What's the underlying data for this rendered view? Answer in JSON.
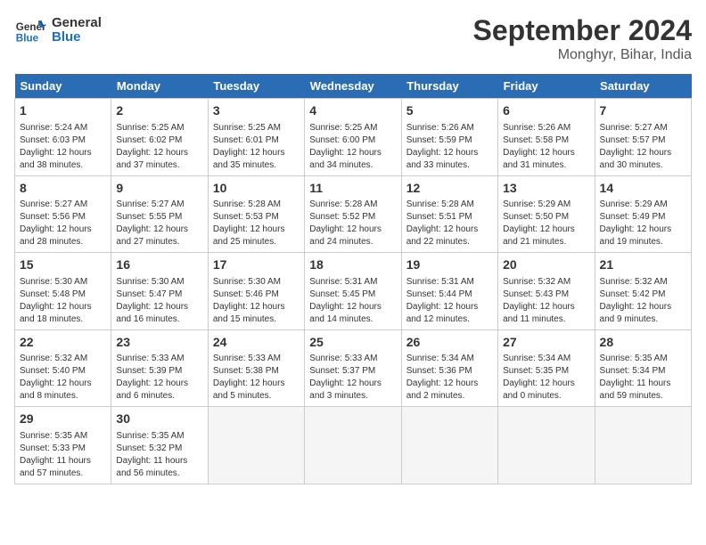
{
  "logo": {
    "line1": "General",
    "line2": "Blue"
  },
  "title": "September 2024",
  "location": "Monghyr, Bihar, India",
  "days_of_week": [
    "Sunday",
    "Monday",
    "Tuesday",
    "Wednesday",
    "Thursday",
    "Friday",
    "Saturday"
  ],
  "weeks": [
    [
      {
        "day": 1,
        "info": "Sunrise: 5:24 AM\nSunset: 6:03 PM\nDaylight: 12 hours\nand 38 minutes."
      },
      {
        "day": 2,
        "info": "Sunrise: 5:25 AM\nSunset: 6:02 PM\nDaylight: 12 hours\nand 37 minutes."
      },
      {
        "day": 3,
        "info": "Sunrise: 5:25 AM\nSunset: 6:01 PM\nDaylight: 12 hours\nand 35 minutes."
      },
      {
        "day": 4,
        "info": "Sunrise: 5:25 AM\nSunset: 6:00 PM\nDaylight: 12 hours\nand 34 minutes."
      },
      {
        "day": 5,
        "info": "Sunrise: 5:26 AM\nSunset: 5:59 PM\nDaylight: 12 hours\nand 33 minutes."
      },
      {
        "day": 6,
        "info": "Sunrise: 5:26 AM\nSunset: 5:58 PM\nDaylight: 12 hours\nand 31 minutes."
      },
      {
        "day": 7,
        "info": "Sunrise: 5:27 AM\nSunset: 5:57 PM\nDaylight: 12 hours\nand 30 minutes."
      }
    ],
    [
      {
        "day": 8,
        "info": "Sunrise: 5:27 AM\nSunset: 5:56 PM\nDaylight: 12 hours\nand 28 minutes."
      },
      {
        "day": 9,
        "info": "Sunrise: 5:27 AM\nSunset: 5:55 PM\nDaylight: 12 hours\nand 27 minutes."
      },
      {
        "day": 10,
        "info": "Sunrise: 5:28 AM\nSunset: 5:53 PM\nDaylight: 12 hours\nand 25 minutes."
      },
      {
        "day": 11,
        "info": "Sunrise: 5:28 AM\nSunset: 5:52 PM\nDaylight: 12 hours\nand 24 minutes."
      },
      {
        "day": 12,
        "info": "Sunrise: 5:28 AM\nSunset: 5:51 PM\nDaylight: 12 hours\nand 22 minutes."
      },
      {
        "day": 13,
        "info": "Sunrise: 5:29 AM\nSunset: 5:50 PM\nDaylight: 12 hours\nand 21 minutes."
      },
      {
        "day": 14,
        "info": "Sunrise: 5:29 AM\nSunset: 5:49 PM\nDaylight: 12 hours\nand 19 minutes."
      }
    ],
    [
      {
        "day": 15,
        "info": "Sunrise: 5:30 AM\nSunset: 5:48 PM\nDaylight: 12 hours\nand 18 minutes."
      },
      {
        "day": 16,
        "info": "Sunrise: 5:30 AM\nSunset: 5:47 PM\nDaylight: 12 hours\nand 16 minutes."
      },
      {
        "day": 17,
        "info": "Sunrise: 5:30 AM\nSunset: 5:46 PM\nDaylight: 12 hours\nand 15 minutes."
      },
      {
        "day": 18,
        "info": "Sunrise: 5:31 AM\nSunset: 5:45 PM\nDaylight: 12 hours\nand 14 minutes."
      },
      {
        "day": 19,
        "info": "Sunrise: 5:31 AM\nSunset: 5:44 PM\nDaylight: 12 hours\nand 12 minutes."
      },
      {
        "day": 20,
        "info": "Sunrise: 5:32 AM\nSunset: 5:43 PM\nDaylight: 12 hours\nand 11 minutes."
      },
      {
        "day": 21,
        "info": "Sunrise: 5:32 AM\nSunset: 5:42 PM\nDaylight: 12 hours\nand 9 minutes."
      }
    ],
    [
      {
        "day": 22,
        "info": "Sunrise: 5:32 AM\nSunset: 5:40 PM\nDaylight: 12 hours\nand 8 minutes."
      },
      {
        "day": 23,
        "info": "Sunrise: 5:33 AM\nSunset: 5:39 PM\nDaylight: 12 hours\nand 6 minutes."
      },
      {
        "day": 24,
        "info": "Sunrise: 5:33 AM\nSunset: 5:38 PM\nDaylight: 12 hours\nand 5 minutes."
      },
      {
        "day": 25,
        "info": "Sunrise: 5:33 AM\nSunset: 5:37 PM\nDaylight: 12 hours\nand 3 minutes."
      },
      {
        "day": 26,
        "info": "Sunrise: 5:34 AM\nSunset: 5:36 PM\nDaylight: 12 hours\nand 2 minutes."
      },
      {
        "day": 27,
        "info": "Sunrise: 5:34 AM\nSunset: 5:35 PM\nDaylight: 12 hours\nand 0 minutes."
      },
      {
        "day": 28,
        "info": "Sunrise: 5:35 AM\nSunset: 5:34 PM\nDaylight: 11 hours\nand 59 minutes."
      }
    ],
    [
      {
        "day": 29,
        "info": "Sunrise: 5:35 AM\nSunset: 5:33 PM\nDaylight: 11 hours\nand 57 minutes."
      },
      {
        "day": 30,
        "info": "Sunrise: 5:35 AM\nSunset: 5:32 PM\nDaylight: 11 hours\nand 56 minutes."
      },
      null,
      null,
      null,
      null,
      null
    ]
  ]
}
